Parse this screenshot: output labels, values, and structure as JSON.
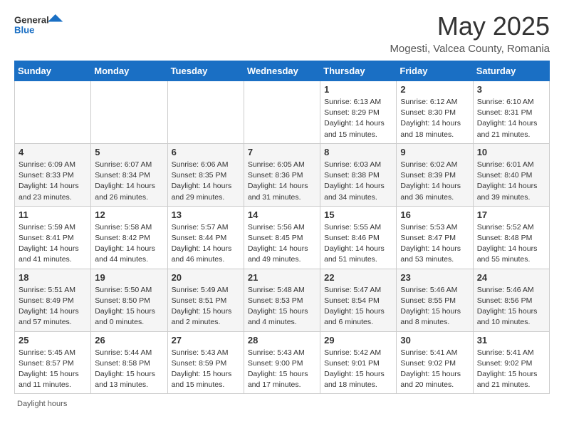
{
  "header": {
    "logo_general": "General",
    "logo_blue": "Blue",
    "month_title": "May 2025",
    "location": "Mogesti, Valcea County, Romania"
  },
  "days_of_week": [
    "Sunday",
    "Monday",
    "Tuesday",
    "Wednesday",
    "Thursday",
    "Friday",
    "Saturday"
  ],
  "footer_label": "Daylight hours",
  "weeks": [
    [
      {
        "day": "",
        "info": ""
      },
      {
        "day": "",
        "info": ""
      },
      {
        "day": "",
        "info": ""
      },
      {
        "day": "",
        "info": ""
      },
      {
        "day": "1",
        "info": "Sunrise: 6:13 AM\nSunset: 8:29 PM\nDaylight: 14 hours\nand 15 minutes."
      },
      {
        "day": "2",
        "info": "Sunrise: 6:12 AM\nSunset: 8:30 PM\nDaylight: 14 hours\nand 18 minutes."
      },
      {
        "day": "3",
        "info": "Sunrise: 6:10 AM\nSunset: 8:31 PM\nDaylight: 14 hours\nand 21 minutes."
      }
    ],
    [
      {
        "day": "4",
        "info": "Sunrise: 6:09 AM\nSunset: 8:33 PM\nDaylight: 14 hours\nand 23 minutes."
      },
      {
        "day": "5",
        "info": "Sunrise: 6:07 AM\nSunset: 8:34 PM\nDaylight: 14 hours\nand 26 minutes."
      },
      {
        "day": "6",
        "info": "Sunrise: 6:06 AM\nSunset: 8:35 PM\nDaylight: 14 hours\nand 29 minutes."
      },
      {
        "day": "7",
        "info": "Sunrise: 6:05 AM\nSunset: 8:36 PM\nDaylight: 14 hours\nand 31 minutes."
      },
      {
        "day": "8",
        "info": "Sunrise: 6:03 AM\nSunset: 8:38 PM\nDaylight: 14 hours\nand 34 minutes."
      },
      {
        "day": "9",
        "info": "Sunrise: 6:02 AM\nSunset: 8:39 PM\nDaylight: 14 hours\nand 36 minutes."
      },
      {
        "day": "10",
        "info": "Sunrise: 6:01 AM\nSunset: 8:40 PM\nDaylight: 14 hours\nand 39 minutes."
      }
    ],
    [
      {
        "day": "11",
        "info": "Sunrise: 5:59 AM\nSunset: 8:41 PM\nDaylight: 14 hours\nand 41 minutes."
      },
      {
        "day": "12",
        "info": "Sunrise: 5:58 AM\nSunset: 8:42 PM\nDaylight: 14 hours\nand 44 minutes."
      },
      {
        "day": "13",
        "info": "Sunrise: 5:57 AM\nSunset: 8:44 PM\nDaylight: 14 hours\nand 46 minutes."
      },
      {
        "day": "14",
        "info": "Sunrise: 5:56 AM\nSunset: 8:45 PM\nDaylight: 14 hours\nand 49 minutes."
      },
      {
        "day": "15",
        "info": "Sunrise: 5:55 AM\nSunset: 8:46 PM\nDaylight: 14 hours\nand 51 minutes."
      },
      {
        "day": "16",
        "info": "Sunrise: 5:53 AM\nSunset: 8:47 PM\nDaylight: 14 hours\nand 53 minutes."
      },
      {
        "day": "17",
        "info": "Sunrise: 5:52 AM\nSunset: 8:48 PM\nDaylight: 14 hours\nand 55 minutes."
      }
    ],
    [
      {
        "day": "18",
        "info": "Sunrise: 5:51 AM\nSunset: 8:49 PM\nDaylight: 14 hours\nand 57 minutes."
      },
      {
        "day": "19",
        "info": "Sunrise: 5:50 AM\nSunset: 8:50 PM\nDaylight: 15 hours\nand 0 minutes."
      },
      {
        "day": "20",
        "info": "Sunrise: 5:49 AM\nSunset: 8:51 PM\nDaylight: 15 hours\nand 2 minutes."
      },
      {
        "day": "21",
        "info": "Sunrise: 5:48 AM\nSunset: 8:53 PM\nDaylight: 15 hours\nand 4 minutes."
      },
      {
        "day": "22",
        "info": "Sunrise: 5:47 AM\nSunset: 8:54 PM\nDaylight: 15 hours\nand 6 minutes."
      },
      {
        "day": "23",
        "info": "Sunrise: 5:46 AM\nSunset: 8:55 PM\nDaylight: 15 hours\nand 8 minutes."
      },
      {
        "day": "24",
        "info": "Sunrise: 5:46 AM\nSunset: 8:56 PM\nDaylight: 15 hours\nand 10 minutes."
      }
    ],
    [
      {
        "day": "25",
        "info": "Sunrise: 5:45 AM\nSunset: 8:57 PM\nDaylight: 15 hours\nand 11 minutes."
      },
      {
        "day": "26",
        "info": "Sunrise: 5:44 AM\nSunset: 8:58 PM\nDaylight: 15 hours\nand 13 minutes."
      },
      {
        "day": "27",
        "info": "Sunrise: 5:43 AM\nSunset: 8:59 PM\nDaylight: 15 hours\nand 15 minutes."
      },
      {
        "day": "28",
        "info": "Sunrise: 5:43 AM\nSunset: 9:00 PM\nDaylight: 15 hours\nand 17 minutes."
      },
      {
        "day": "29",
        "info": "Sunrise: 5:42 AM\nSunset: 9:01 PM\nDaylight: 15 hours\nand 18 minutes."
      },
      {
        "day": "30",
        "info": "Sunrise: 5:41 AM\nSunset: 9:02 PM\nDaylight: 15 hours\nand 20 minutes."
      },
      {
        "day": "31",
        "info": "Sunrise: 5:41 AM\nSunset: 9:02 PM\nDaylight: 15 hours\nand 21 minutes."
      }
    ]
  ]
}
